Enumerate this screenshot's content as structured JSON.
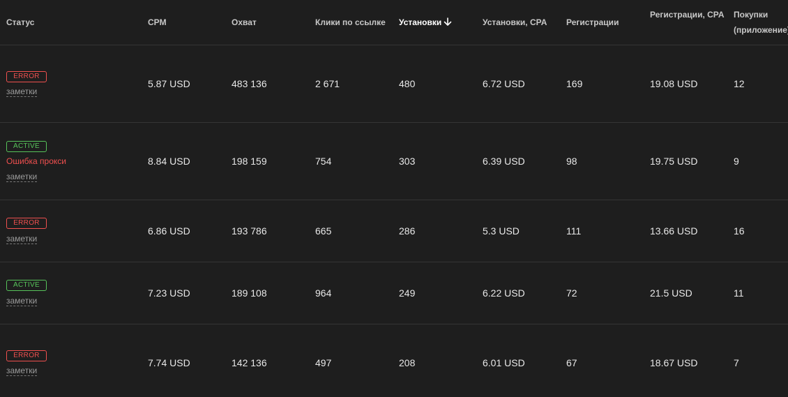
{
  "headers": {
    "status": "Статус",
    "cpm": "CPM",
    "reach": "Охват",
    "clicks": "Клики по ссылке",
    "installs": "Установки",
    "installs_cpa": "Установки, CPA",
    "registrations": "Регистрации",
    "registrations_cpa": "Регистрации, CPA",
    "purchases_line1": "Покупки",
    "purchases_line2": "(приложение)"
  },
  "sort": {
    "column": "installs",
    "direction": "desc",
    "icon": "arrow-down-icon"
  },
  "colors": {
    "error": "#f0504f",
    "active": "#57c35a",
    "background": "#1e1e1e"
  },
  "rows": [
    {
      "status": "ERROR",
      "status_type": "error",
      "error_text": "",
      "notes": "заметки",
      "cpm": "5.87 USD",
      "reach": "483 136",
      "clicks": "2 671",
      "installs": "480",
      "installs_cpa": "6.72 USD",
      "registrations": "169",
      "registrations_cpa": "19.08 USD",
      "purchases": "12"
    },
    {
      "status": "ACTIVE",
      "status_type": "active",
      "error_text": "Ошибка прокси",
      "notes": "заметки",
      "cpm": "8.84 USD",
      "reach": "198 159",
      "clicks": "754",
      "installs": "303",
      "installs_cpa": "6.39 USD",
      "registrations": "98",
      "registrations_cpa": "19.75 USD",
      "purchases": "9"
    },
    {
      "status": "ERROR",
      "status_type": "error",
      "error_text": "",
      "notes": "заметки",
      "cpm": "6.86 USD",
      "reach": "193 786",
      "clicks": "665",
      "installs": "286",
      "installs_cpa": "5.3 USD",
      "registrations": "111",
      "registrations_cpa": "13.66 USD",
      "purchases": "16"
    },
    {
      "status": "ACTIVE",
      "status_type": "active",
      "error_text": "",
      "notes": "заметки",
      "cpm": "7.23 USD",
      "reach": "189 108",
      "clicks": "964",
      "installs": "249",
      "installs_cpa": "6.22 USD",
      "registrations": "72",
      "registrations_cpa": "21.5 USD",
      "purchases": "11"
    },
    {
      "status": "ERROR",
      "status_type": "error",
      "error_text": "",
      "notes": "заметки",
      "cpm": "7.74 USD",
      "reach": "142 136",
      "clicks": "497",
      "installs": "208",
      "installs_cpa": "6.01 USD",
      "registrations": "67",
      "registrations_cpa": "18.67 USD",
      "purchases": "7"
    }
  ]
}
